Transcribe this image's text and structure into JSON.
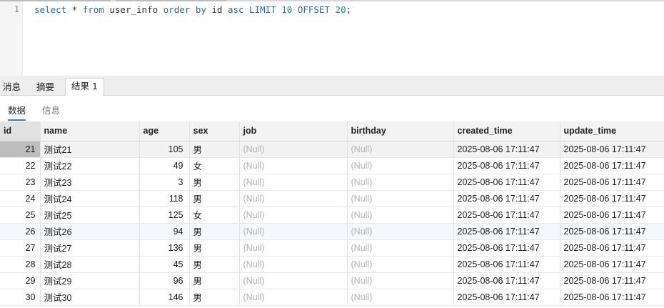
{
  "editor": {
    "line_number": "1",
    "tokens": [
      {
        "t": "select",
        "c": "kw"
      },
      {
        "t": " * ",
        "c": "plain"
      },
      {
        "t": "from",
        "c": "kw"
      },
      {
        "t": " user_info ",
        "c": "plain"
      },
      {
        "t": "order",
        "c": "kw"
      },
      {
        "t": " ",
        "c": "plain"
      },
      {
        "t": "by",
        "c": "kw"
      },
      {
        "t": " id ",
        "c": "plain"
      },
      {
        "t": "asc",
        "c": "kw"
      },
      {
        "t": " ",
        "c": "plain"
      },
      {
        "t": "LIMIT",
        "c": "kw"
      },
      {
        "t": " ",
        "c": "plain"
      },
      {
        "t": "10",
        "c": "num"
      },
      {
        "t": " ",
        "c": "plain"
      },
      {
        "t": "OFFSET",
        "c": "kw"
      },
      {
        "t": " ",
        "c": "plain"
      },
      {
        "t": "20",
        "c": "num"
      },
      {
        "t": ";",
        "c": "plain"
      }
    ]
  },
  "tabs": {
    "messages": "消息",
    "summary": "摘要",
    "result1": "结果 1"
  },
  "subtabs": {
    "data": "数据",
    "info": "信息"
  },
  "grid": {
    "columns": [
      "id",
      "name",
      "age",
      "sex",
      "job",
      "birthday",
      "created_time",
      "update_time"
    ],
    "rows": [
      [
        "21",
        "测试21",
        "105",
        "男",
        "(Null)",
        "(Null)",
        "2025-08-06 17:11:47",
        "2025-08-06 17:11:47"
      ],
      [
        "22",
        "测试22",
        "49",
        "女",
        "(Null)",
        "(Null)",
        "2025-08-06 17:11:47",
        "2025-08-06 17:11:47"
      ],
      [
        "23",
        "测试23",
        "3",
        "男",
        "(Null)",
        "(Null)",
        "2025-08-06 17:11:47",
        "2025-08-06 17:11:47"
      ],
      [
        "24",
        "测试24",
        "118",
        "男",
        "(Null)",
        "(Null)",
        "2025-08-06 17:11:47",
        "2025-08-06 17:11:47"
      ],
      [
        "25",
        "测试25",
        "125",
        "女",
        "(Null)",
        "(Null)",
        "2025-08-06 17:11:47",
        "2025-08-06 17:11:47"
      ],
      [
        "26",
        "测试26",
        "94",
        "男",
        "(Null)",
        "(Null)",
        "2025-08-06 17:11:47",
        "2025-08-06 17:11:47"
      ],
      [
        "27",
        "测试27",
        "136",
        "男",
        "(Null)",
        "(Null)",
        "2025-08-06 17:11:47",
        "2025-08-06 17:11:47"
      ],
      [
        "28",
        "测试28",
        "45",
        "男",
        "(Null)",
        "(Null)",
        "2025-08-06 17:11:47",
        "2025-08-06 17:11:47"
      ],
      [
        "29",
        "测试29",
        "96",
        "男",
        "(Null)",
        "(Null)",
        "2025-08-06 17:11:47",
        "2025-08-06 17:11:47"
      ],
      [
        "30",
        "测试30",
        "146",
        "男",
        "(Null)",
        "(Null)",
        "2025-08-06 17:11:47",
        "2025-08-06 17:11:47"
      ]
    ]
  }
}
